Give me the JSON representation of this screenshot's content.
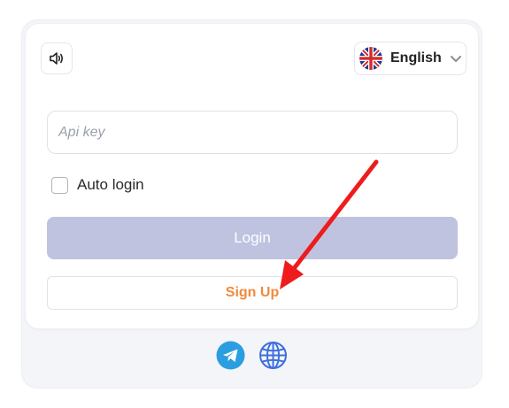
{
  "header": {
    "sound_icon": "speaker-icon",
    "language": {
      "selected": "English",
      "flag": "uk-flag-icon",
      "chevron": "chevron-down-icon"
    }
  },
  "form": {
    "api_key": {
      "placeholder": "Api key",
      "value": ""
    },
    "auto_login": {
      "label": "Auto login",
      "checked": false
    },
    "login_label": "Login",
    "signup_label": "Sign Up"
  },
  "footer": {
    "icons": [
      "telegram-icon",
      "globe-icon"
    ]
  },
  "colors": {
    "login_bg": "#bfc3e0",
    "signup_text": "#f08a3c",
    "telegram": "#2a9ee0",
    "globe": "#3d6fe0",
    "arrow": "#ee1c1c"
  }
}
